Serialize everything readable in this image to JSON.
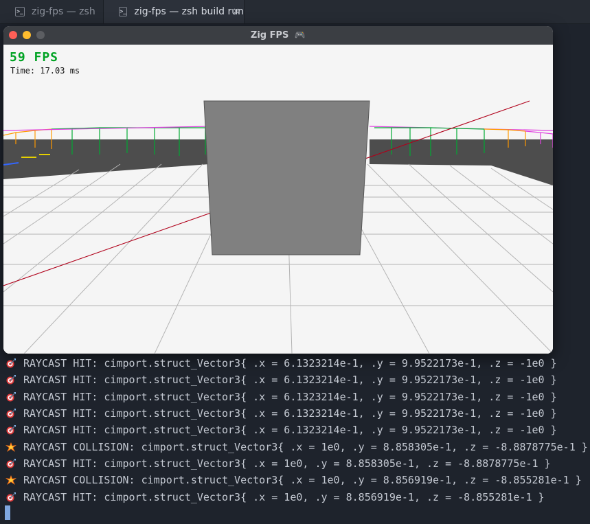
{
  "tabs": [
    {
      "label": "zig-fps — zsh",
      "icon": "terminal-icon",
      "prompt_glyph": ">_"
    },
    {
      "label": "zig-fps — zsh build run",
      "icon": "terminal-icon",
      "prompt_glyph": ">_",
      "close": "×",
      "active": true
    }
  ],
  "window": {
    "title": "Zig FPS",
    "title_icon": "gamepad-icon",
    "title_glyph": "🎮",
    "hud": {
      "fps_text": "59 FPS",
      "frame_time_text": "Time: 17.03 ms"
    }
  },
  "terminal": {
    "lines": [
      {
        "kind": "hit",
        "icon": "target-icon",
        "text": "RAYCAST HIT: cimport.struct_Vector3{ .x = 6.1323214e-1, .y = 9.9522173e-1, .z = -1e0 }"
      },
      {
        "kind": "hit",
        "icon": "target-icon",
        "text": "RAYCAST HIT: cimport.struct_Vector3{ .x = 6.1323214e-1, .y = 9.9522173e-1, .z = -1e0 }"
      },
      {
        "kind": "hit",
        "icon": "target-icon",
        "text": "RAYCAST HIT: cimport.struct_Vector3{ .x = 6.1323214e-1, .y = 9.9522173e-1, .z = -1e0 }"
      },
      {
        "kind": "hit",
        "icon": "target-icon",
        "text": "RAYCAST HIT: cimport.struct_Vector3{ .x = 6.1323214e-1, .y = 9.9522173e-1, .z = -1e0 }"
      },
      {
        "kind": "hit",
        "icon": "target-icon",
        "text": "RAYCAST HIT: cimport.struct_Vector3{ .x = 6.1323214e-1, .y = 9.9522173e-1, .z = -1e0 }"
      },
      {
        "kind": "collision",
        "icon": "collision-icon",
        "text": "RAYCAST COLLISION: cimport.struct_Vector3{ .x = 1e0, .y = 8.858305e-1, .z = -8.8878775e-1 }"
      },
      {
        "kind": "hit",
        "icon": "target-icon",
        "text": "RAYCAST HIT: cimport.struct_Vector3{ .x = 1e0, .y = 8.858305e-1, .z = -8.8878775e-1 }"
      },
      {
        "kind": "collision",
        "icon": "collision-icon",
        "text": "RAYCAST COLLISION: cimport.struct_Vector3{ .x = 1e0, .y = 8.856919e-1, .z = -8.855281e-1 }"
      },
      {
        "kind": "hit",
        "icon": "target-icon",
        "text": "RAYCAST HIT: cimport.struct_Vector3{ .x = 1e0, .y = 8.856919e-1, .z = -8.855281e-1 }"
      }
    ]
  },
  "colors": {
    "hud_fps": "#00a323",
    "cube": "#808080",
    "ray": "#b0001a",
    "wall": "#4d4d4d",
    "floor": "#f5f5f5",
    "cursor": "#7fa7e0"
  }
}
